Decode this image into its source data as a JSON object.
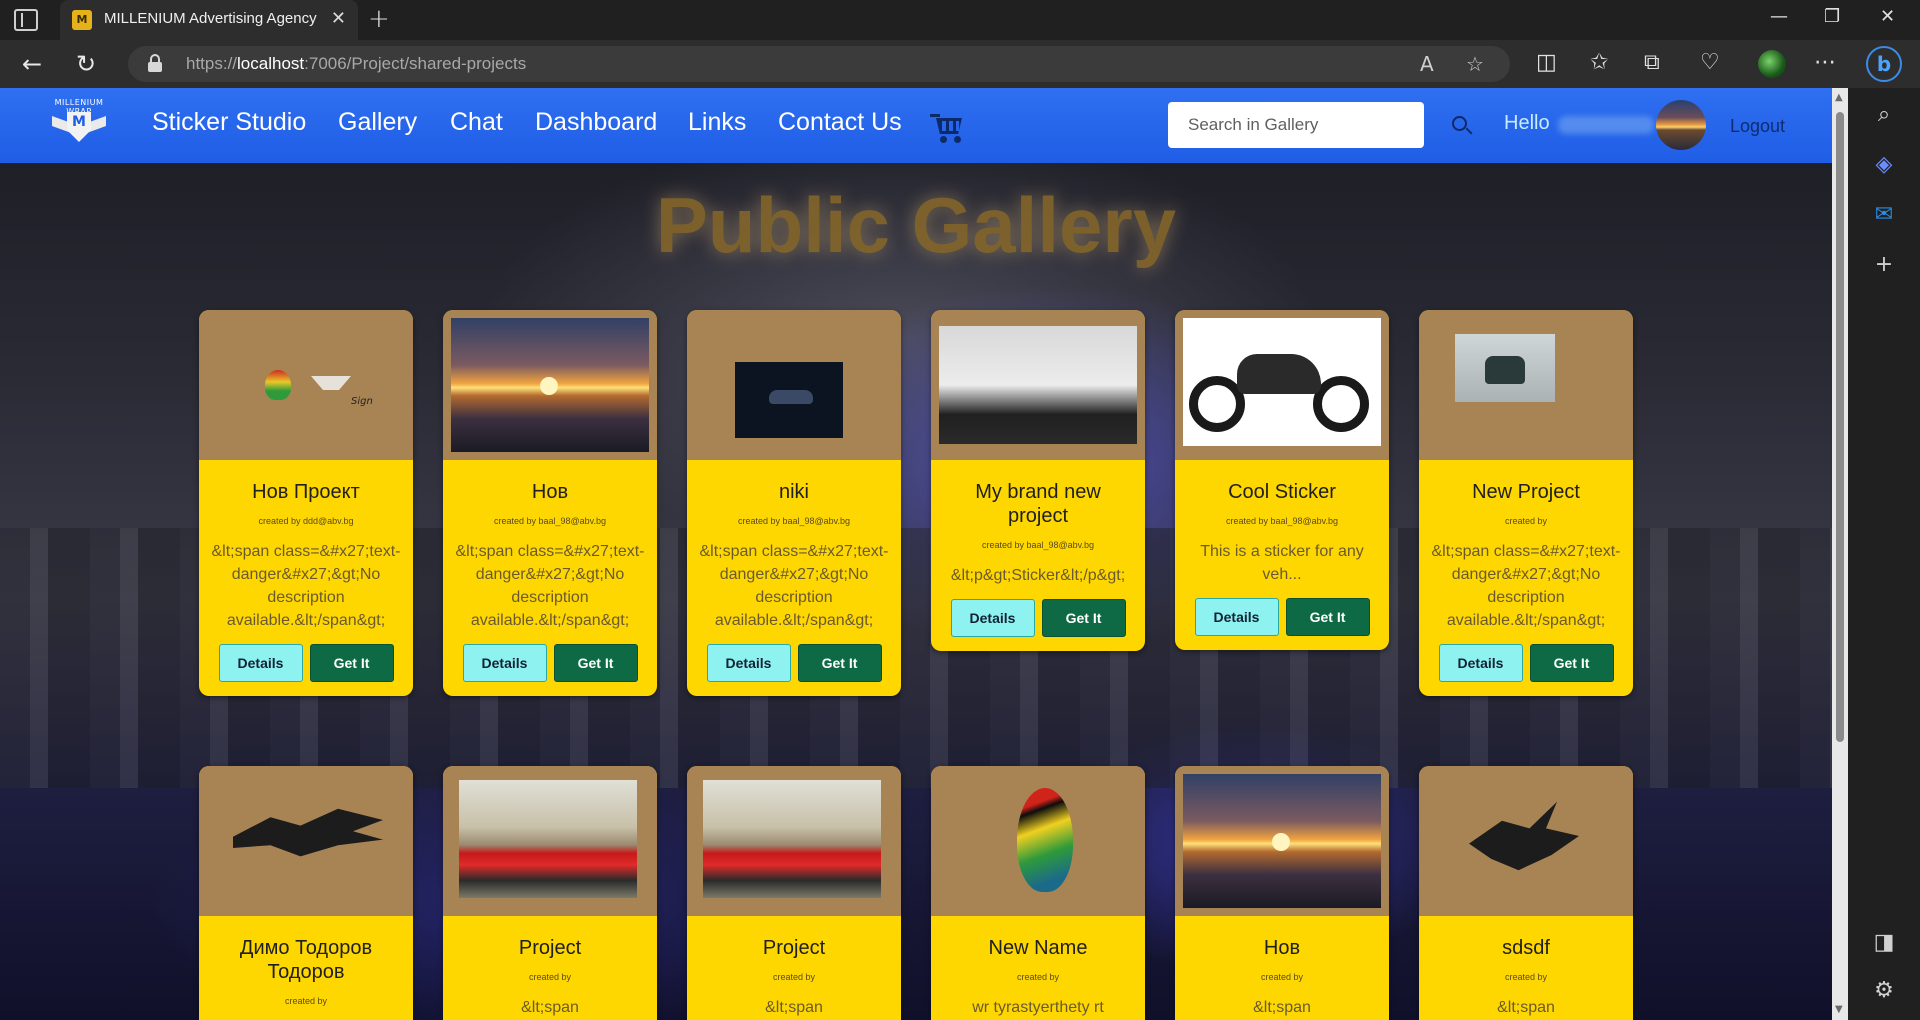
{
  "browser": {
    "tab_title": "MILLENIUM Advertising Agency",
    "url_prefix": "https://",
    "url_host": "localhost",
    "url_path": ":7006/Project/shared-projects"
  },
  "site": {
    "nav": [
      "Sticker Studio",
      "Gallery",
      "Chat",
      "Dashboard",
      "Links",
      "Contact Us"
    ],
    "search_placeholder": "Search in Gallery",
    "hello": "Hello",
    "logout": "Logout",
    "logo_text": "MILLENIUM WRAP"
  },
  "page": {
    "heading": "Public Gallery"
  },
  "buttons": {
    "details": "Details",
    "get_it": "Get It"
  },
  "cards": [
    {
      "title": "Нов Проект",
      "creator": "created by ddd@abv.bg",
      "desc": "&lt;span class=&#x27;text-danger&#x27;&gt;No description available.&lt;/span&gt;",
      "thumb": "logo-collage"
    },
    {
      "title": "Нов",
      "creator": "created by baal_98@abv.bg",
      "desc": "&lt;span class=&#x27;text-danger&#x27;&gt;No description available.&lt;/span&gt;",
      "thumb": "sunset"
    },
    {
      "title": "niki",
      "creator": "created by baal_98@abv.bg",
      "desc": "&lt;span class=&#x27;text-danger&#x27;&gt;No description available.&lt;/span&gt;",
      "thumb": "dark-car"
    },
    {
      "title": "My brand new project",
      "creator": "created by baal_98@abv.bg",
      "desc": "&lt;p&gt;Sticker&lt;/p&gt;",
      "thumb": "car-photo"
    },
    {
      "title": "Cool Sticker",
      "creator": "created by baal_98@abv.bg",
      "desc": "This is a sticker for any veh...",
      "thumb": "motorcycle"
    },
    {
      "title": "New Project",
      "creator": "created by",
      "desc": "&lt;span class=&#x27;text-danger&#x27;&gt;No description available.&lt;/span&gt;",
      "thumb": "phone"
    },
    {
      "title": "Димо Тодоров Тодоров",
      "creator": "created by",
      "desc": "",
      "thumb": "flame"
    },
    {
      "title": "Project",
      "creator": "created by",
      "desc": "&lt;span",
      "thumb": "red-car"
    },
    {
      "title": "Project",
      "creator": "created by",
      "desc": "&lt;span",
      "thumb": "red-car"
    },
    {
      "title": "New Name",
      "creator": "created by",
      "desc": "wr tyrastyerthety rt",
      "thumb": "parrot"
    },
    {
      "title": "Нов",
      "creator": "created by",
      "desc": "&lt;span",
      "thumb": "sunset"
    },
    {
      "title": "sdsdf",
      "creator": "created by",
      "desc": "&lt;span",
      "thumb": "flame2"
    }
  ],
  "icons": {
    "cart": "shopping-cart-icon",
    "search": "search-icon",
    "edge_sidebar": [
      "search-icon",
      "copilot-icon",
      "outlook-icon",
      "add-icon",
      "sidebar-toggle-icon",
      "settings-icon"
    ]
  }
}
